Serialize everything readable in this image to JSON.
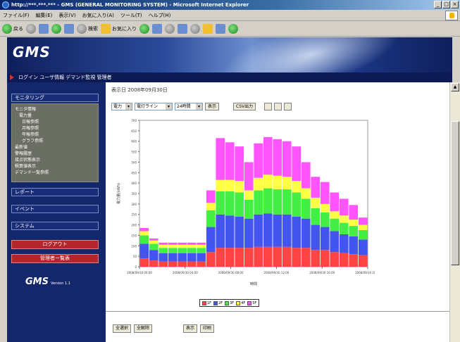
{
  "window": {
    "title": "http://***.***.*** - GMS (GENERAL MONITORING SYSTEM) - Microsoft Internet Explorer",
    "controls": [
      "_",
      "□",
      "×"
    ]
  },
  "menubar": [
    "ファイル(F)",
    "編集(E)",
    "表示(V)",
    "お気に入り(A)",
    "ツール(T)",
    "ヘルプ(H)"
  ],
  "toolbar": {
    "back_label": "戻る",
    "search_label": "検索",
    "favorites_label": "お気に入り"
  },
  "banner": {
    "logo": "GMS"
  },
  "navstrip": {
    "text": "ログイン ユーザ情報 デマンド監視 管理者"
  },
  "sidebar": {
    "sections": [
      "モニタリング",
      "レポート",
      "イベント",
      "システム"
    ],
    "tree_items": [
      "モニタ情報",
      "電力量",
      "日報参照",
      "月報参照",
      "年報参照",
      "グラフ参照",
      "最新値",
      "警報履歴",
      "接点状態表示",
      "積算値表示",
      "デマンド一覧参照"
    ],
    "buttons": [
      "ログアウト",
      "管理者ー覧表"
    ],
    "logo": "GMS",
    "logo_sub": "Version 1.1"
  },
  "main": {
    "page_title": "表示日 2008年09月30日",
    "controls": {
      "select1": "電力",
      "select2": "電灯ライン",
      "select3": "24時間",
      "show_button": "表示",
      "csv_button": "CSV出力"
    },
    "legend": [
      "1F",
      "2F",
      "3F",
      "4F",
      "5F"
    ],
    "footer_buttons": [
      "全選択",
      "全解除",
      "表示",
      "印刷"
    ]
  },
  "chart_data": {
    "type": "bar",
    "stacked": true,
    "xlabel": "時間",
    "ylabel": "電力量(kWh)",
    "ylim": [
      0,
      700
    ],
    "ytick_labels": [
      "0",
      "50",
      "100",
      "150",
      "200",
      "250",
      "300",
      "350",
      "400",
      "450",
      "500",
      "550",
      "600",
      "650",
      "700"
    ],
    "xtick_labels": [
      "2008/09/30 00:00",
      "2008/09/30 04:00",
      "2008/09/30 08:00",
      "2008/09/30 12:00",
      "2008/09/30 16:00",
      "2008/09/30 20:00"
    ],
    "categories": [
      "0",
      "1",
      "2",
      "3",
      "4",
      "5",
      "6",
      "7",
      "8",
      "9",
      "10",
      "11",
      "12",
      "13",
      "14",
      "15",
      "16",
      "17",
      "18",
      "19",
      "20",
      "21",
      "22",
      "23"
    ],
    "series": [
      {
        "name": "1F",
        "color": "#ff4444",
        "values": [
          40,
          30,
          25,
          25,
          25,
          25,
          25,
          70,
          90,
          90,
          90,
          90,
          95,
          95,
          95,
          95,
          90,
          90,
          80,
          80,
          70,
          65,
          60,
          55
        ]
      },
      {
        "name": "2F",
        "color": "#4455ee",
        "values": [
          70,
          50,
          40,
          40,
          40,
          40,
          40,
          120,
          160,
          155,
          150,
          140,
          155,
          160,
          155,
          155,
          150,
          140,
          120,
          110,
          100,
          90,
          85,
          75
        ]
      },
      {
        "name": "3F",
        "color": "#44ee44",
        "values": [
          40,
          30,
          25,
          25,
          25,
          25,
          25,
          80,
          110,
          115,
          115,
          90,
          115,
          120,
          120,
          120,
          115,
          95,
          80,
          70,
          60,
          55,
          50,
          45
        ]
      },
      {
        "name": "4F",
        "color": "#ffff44",
        "values": [
          20,
          15,
          15,
          15,
          15,
          15,
          15,
          35,
          55,
          55,
          55,
          45,
          60,
          65,
          65,
          60,
          55,
          50,
          50,
          40,
          35,
          35,
          30,
          25
        ]
      },
      {
        "name": "5F",
        "color": "#ff55ff",
        "values": [
          15,
          10,
          10,
          10,
          10,
          10,
          10,
          60,
          200,
          180,
          165,
          135,
          165,
          180,
          175,
          170,
          165,
          125,
          100,
          105,
          90,
          80,
          70,
          35
        ]
      }
    ]
  }
}
